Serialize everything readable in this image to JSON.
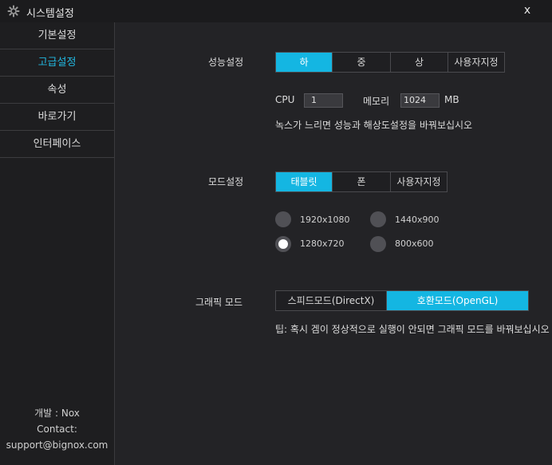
{
  "window": {
    "title": "시스템설정",
    "close_label": "x"
  },
  "sidebar": {
    "items": [
      {
        "label": "기본설정"
      },
      {
        "label": "고급설정"
      },
      {
        "label": "속성"
      },
      {
        "label": "바로가기"
      },
      {
        "label": "인터페이스"
      }
    ],
    "active_index": 1,
    "footer": {
      "developer": "개발 : Nox",
      "contact_label": "Contact:",
      "email": "support@bignox.com"
    }
  },
  "performance": {
    "label": "성능설정",
    "options": [
      "하",
      "중",
      "상",
      "사용자지정"
    ],
    "selected": "하",
    "cpu_label": "CPU",
    "cpu_value": "1",
    "memory_label": "메모리",
    "memory_value": "1024",
    "memory_unit": "MB",
    "hint": "녹스가 느리면 성능과 해상도설정을 바꿔보십시오"
  },
  "mode": {
    "label": "모드설정",
    "options": [
      "태블릿",
      "폰",
      "사용자지정"
    ],
    "selected": "태블릿",
    "resolutions": [
      "1920x1080",
      "1440x900",
      "1280x720",
      "800x600"
    ],
    "selected_resolution": "1280x720"
  },
  "graphics": {
    "label": "그래픽 모드",
    "options": [
      "스피드모드(DirectX)",
      "호환모드(OpenGL)"
    ],
    "selected": "호환모드(OpenGL)",
    "tip": "팁: 혹시 겜이 정상적으로 실행이 안되면 그래픽 모드를 바꿔보십시오"
  },
  "colors": {
    "accent": "#14b6e2",
    "active_nav": "#22b8e0",
    "background": "#232326"
  }
}
